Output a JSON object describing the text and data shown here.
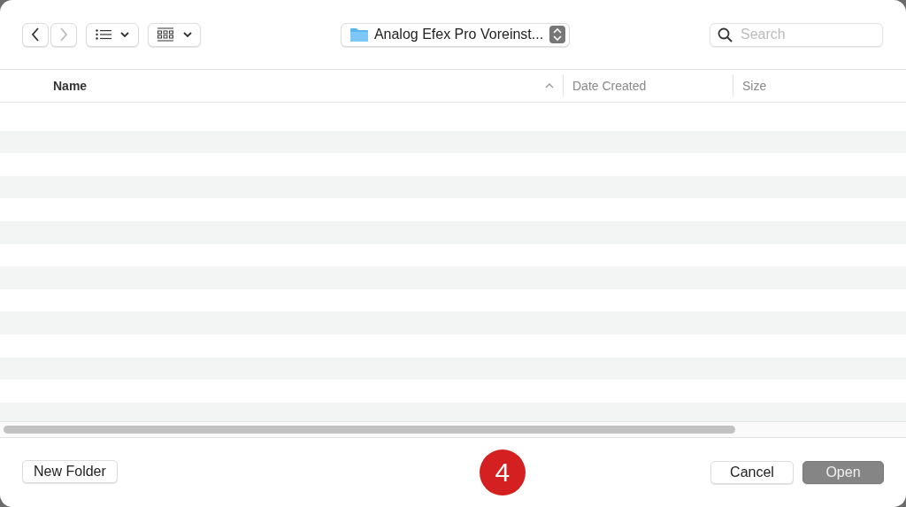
{
  "toolbar": {
    "location": "Analog Efex Pro Voreinst...",
    "search": {
      "placeholder": "Search"
    }
  },
  "table": {
    "columns": [
      {
        "label": "Name",
        "sorted": true
      },
      {
        "label": "Date Created",
        "sorted": false
      },
      {
        "label": "Size",
        "sorted": false
      }
    ]
  },
  "footer": {
    "new_folder": "New Folder",
    "badge": "4",
    "cancel": "Cancel",
    "open": {
      "label": "Open",
      "disabled": true
    }
  }
}
